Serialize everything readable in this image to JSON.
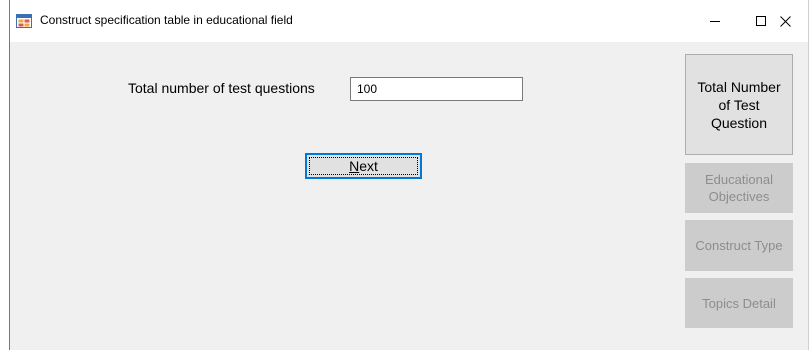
{
  "window": {
    "title": "Construct specification table in educational field",
    "minimize_glyph": "—",
    "maximize_glyph": "☐",
    "close_glyph": "✕"
  },
  "form": {
    "total_label": "Total number of test questions",
    "total_value": "100",
    "next_mnemonic": "N",
    "next_rest": "ext"
  },
  "sidebar": {
    "items": [
      {
        "label": "Total Number of Test Question",
        "enabled": true
      },
      {
        "label": "Educational Objectives",
        "enabled": false
      },
      {
        "label": "Construct Type",
        "enabled": false
      },
      {
        "label": "Topics Detail",
        "enabled": false
      }
    ]
  },
  "colors": {
    "focus_border": "#0078d7",
    "disabled_bg": "#cccccc",
    "disabled_text": "#8d8d8d"
  },
  "icons": {
    "app": "app-form-icon"
  }
}
